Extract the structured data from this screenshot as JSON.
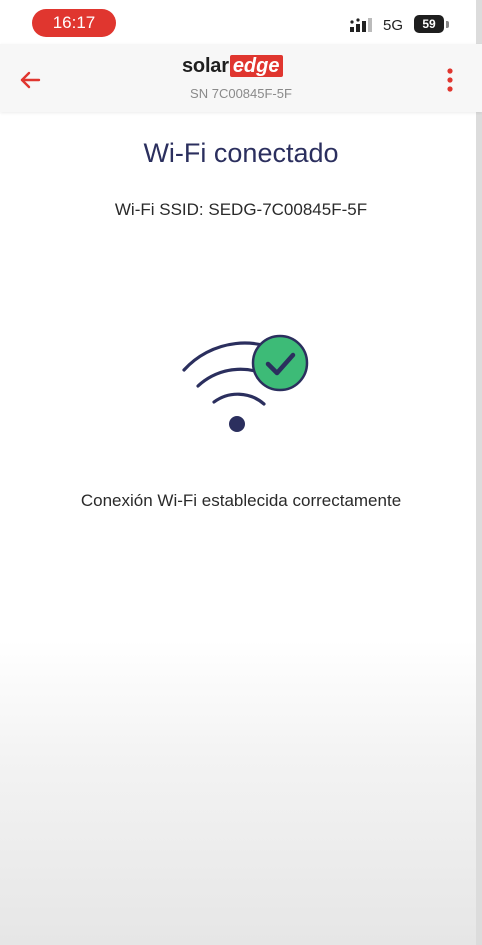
{
  "status_bar": {
    "time": "16:17",
    "network": "5G",
    "battery": "59"
  },
  "header": {
    "logo_solar": "solar",
    "logo_edge": "edge",
    "serial": "SN 7C00845F-5F"
  },
  "main": {
    "title": "Wi-Fi conectado",
    "ssid_text": "Wi-Fi SSID: SEDG-7C00845F-5F",
    "message": "Conexión Wi-Fi establecida correctamente"
  },
  "colors": {
    "accent": "#e0362f",
    "title": "#2b2f5e",
    "success": "#3dbb77"
  },
  "icons": {
    "back": "arrow-left-icon",
    "menu": "more-vertical-icon",
    "status": "wifi-connected-check-icon"
  }
}
